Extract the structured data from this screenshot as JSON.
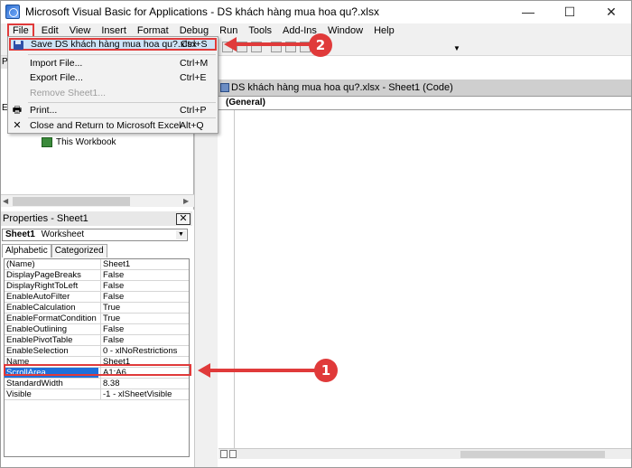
{
  "window": {
    "title": "Microsoft Visual Basic for Applications - DS khách hàng mua hoa qu?.xlsx",
    "minimize": "—",
    "maximize": "☐",
    "close": "✕"
  },
  "menubar": [
    "File",
    "Edit",
    "View",
    "Insert",
    "Format",
    "Debug",
    "Run",
    "Tools",
    "Add-Ins",
    "Window",
    "Help"
  ],
  "file_menu": {
    "items": [
      {
        "label": "Save DS khách hàng mua hoa qu?.xlsx",
        "shortcut": "Ctrl+S",
        "icon": "floppy-disk-icon"
      },
      {
        "label": "Import File...",
        "shortcut": "Ctrl+M"
      },
      {
        "label": "Export File...",
        "shortcut": "Ctrl+E"
      },
      {
        "label": "Remove Sheet1...",
        "shortcut": "",
        "disabled": true
      },
      {
        "label": "Print...",
        "shortcut": "Ctrl+P",
        "icon": "printer-icon"
      },
      {
        "label": "Close and Return to Microsoft Excel",
        "shortcut": "Alt+Q",
        "icon": "close-x-icon"
      }
    ]
  },
  "project": {
    "header": "P",
    "items": [
      "E",
      "This Workbook"
    ]
  },
  "properties": {
    "title": "Properties - Sheet1",
    "close": "✕",
    "object_name": "Sheet1",
    "object_type": "Worksheet",
    "tabs": [
      "Alphabetic",
      "Categorized"
    ],
    "rows": [
      {
        "name": "(Name)",
        "value": "Sheet1"
      },
      {
        "name": "DisplayPageBreaks",
        "value": "False"
      },
      {
        "name": "DisplayRightToLeft",
        "value": "False"
      },
      {
        "name": "EnableAutoFilter",
        "value": "False"
      },
      {
        "name": "EnableCalculation",
        "value": "True"
      },
      {
        "name": "EnableFormatConditionsCal",
        "value": "True"
      },
      {
        "name": "EnableOutlining",
        "value": "False"
      },
      {
        "name": "EnablePivotTable",
        "value": "False"
      },
      {
        "name": "EnableSelection",
        "value": "0 - xlNoRestrictions"
      },
      {
        "name": "Name",
        "value": "Sheet1"
      },
      {
        "name": "ScrollArea",
        "value": "A1:A6"
      },
      {
        "name": "StandardWidth",
        "value": "8.38"
      },
      {
        "name": "Visible",
        "value": "-1 - xlSheetVisible"
      }
    ]
  },
  "code_window": {
    "title": "DS khách hàng mua hoa qu?.xlsx - Sheet1 (Code)",
    "object_combo": "(General)"
  },
  "annotations": {
    "callout_1": "1",
    "callout_2": "2"
  },
  "colors": {
    "annotation_red": "#e03a3a",
    "selection_blue": "#1e6fd9",
    "menu_highlight": "#cde3f7"
  }
}
